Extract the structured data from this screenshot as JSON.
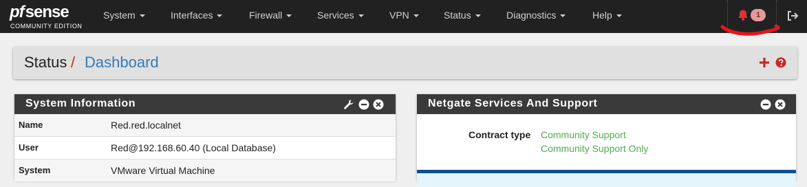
{
  "brand": {
    "logo_text_pf": "pf",
    "logo_text_sense": "sense",
    "edition": "COMMUNITY EDITION"
  },
  "navbar": {
    "menus": [
      "System",
      "Interfaces",
      "Firewall",
      "Services",
      "VPN",
      "Status",
      "Diagnostics",
      "Help"
    ],
    "notification_count": "1"
  },
  "breadcrumb": {
    "section": "Status",
    "separator": "/",
    "page": "Dashboard"
  },
  "widgets": {
    "system_information": {
      "title": "System Information",
      "rows": [
        {
          "label": "Name",
          "value": "Red.red.localnet"
        },
        {
          "label": "User",
          "value": "Red@192.168.60.40 (Local Database)"
        },
        {
          "label": "System",
          "value": "VMware Virtual Machine"
        }
      ]
    },
    "netgate_support": {
      "title": "Netgate Services And Support",
      "contract_label": "Contract type",
      "contract_values": [
        "Community Support",
        "Community Support Only"
      ]
    }
  },
  "colors": {
    "navbar": "#212121",
    "accent_red": "#c62828",
    "link_blue": "#337ab7",
    "success_green": "#4cae4c",
    "annotation_red": "#e8141c"
  }
}
